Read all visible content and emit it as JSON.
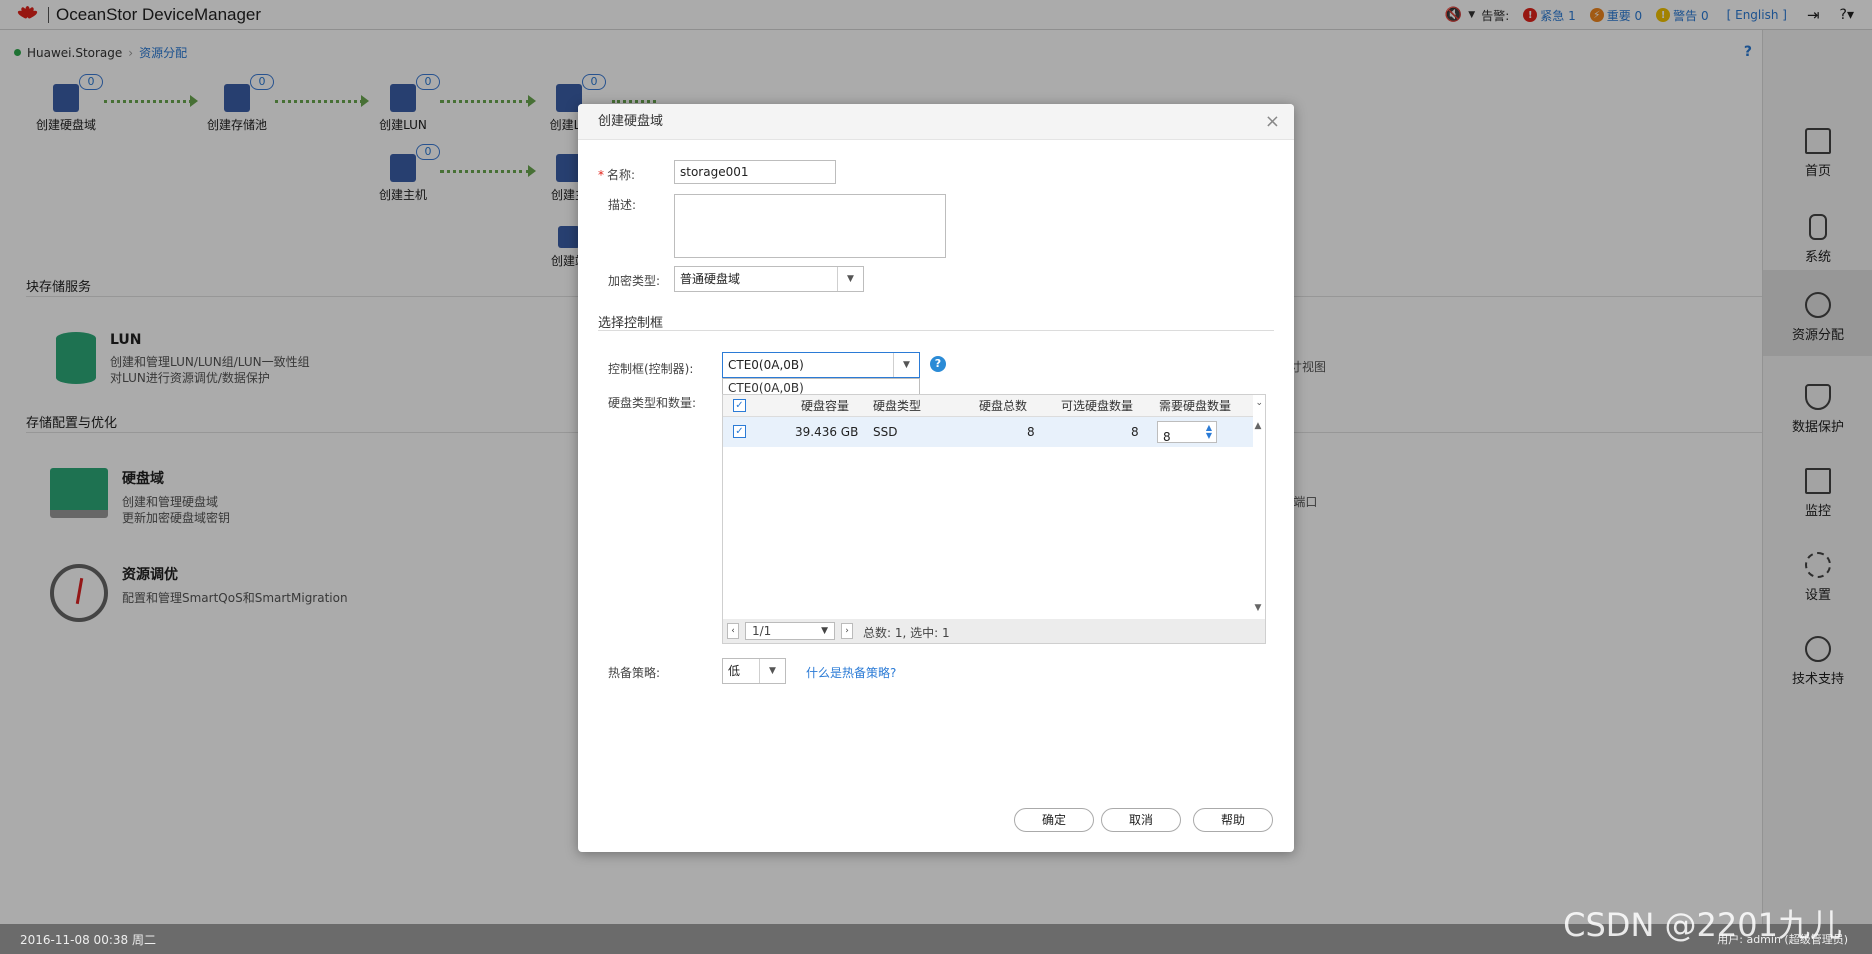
{
  "topbar": {
    "title": "OceanStor DeviceManager",
    "alarm_label": "告警:",
    "critical": "紧急 1",
    "major": "重要 0",
    "warning": "警告 0",
    "language": "[ English ]"
  },
  "breadcrumb": {
    "root": "Huawei.Storage",
    "current": "资源分配"
  },
  "flow": {
    "create_disk_domain": "创建硬盘域",
    "create_pool": "创建存储池",
    "create_lun": "创建LUN",
    "create_lun_group": "创建LU",
    "create_host": "创建主机",
    "create_host_group": "创建主",
    "create_port": "创建端",
    "count": "0"
  },
  "sections": {
    "block_service": "块存储服务",
    "storage_config": "存储配置与优化"
  },
  "cards": {
    "lun_title": "LUN",
    "lun_desc1": "创建和管理LUN/LUN组/LUN一致性组",
    "lun_desc2": "对LUN进行资源调优/数据保护",
    "disk_domain_title": "硬盘域",
    "disk_domain_desc1": "创建和管理硬盘域",
    "disk_domain_desc2": "更新加密硬盘域密钥",
    "tuning_title": "资源调优",
    "tuning_desc": "配置和管理SmartQoS和SmartMigration",
    "right_fragment1": "寸视图",
    "right_fragment2": "l端口"
  },
  "side_nav": [
    "首页",
    "系统",
    "资源分配",
    "数据保护",
    "监控",
    "设置",
    "技术支持"
  ],
  "status": {
    "datetime": "2016-11-08 00:38 周二",
    "user": "用户: admin (超级管理员)",
    "watermark": "CSDN @2201九儿"
  },
  "dialog": {
    "title": "创建硬盘域",
    "name_label": "名称:",
    "name_value": "storage001",
    "desc_label": "描述:",
    "encrypt_label": "加密类型:",
    "encrypt_value": "普通硬盘域",
    "group_title": "选择控制框",
    "controller_label": "控制框(控制器):",
    "controller_value": "CTE0(0A,0B)",
    "controller_option": "CTE0(0A,0B)",
    "disk_label": "硬盘类型和数量:",
    "columns": [
      "硬盘容量",
      "硬盘类型",
      "硬盘总数",
      "可选硬盘数量",
      "需要硬盘数量"
    ],
    "row": {
      "capacity": "39.436 GB",
      "type": "SSD",
      "total": "8",
      "available": "8",
      "required": "8"
    },
    "pager_page": "1/1",
    "pager_info": "总数: 1, 选中: 1",
    "hotspare_label": "热备策略:",
    "hotspare_value": "低",
    "hotspare_help": "什么是热备策略?",
    "ok": "确定",
    "cancel": "取消",
    "help": "帮助"
  }
}
